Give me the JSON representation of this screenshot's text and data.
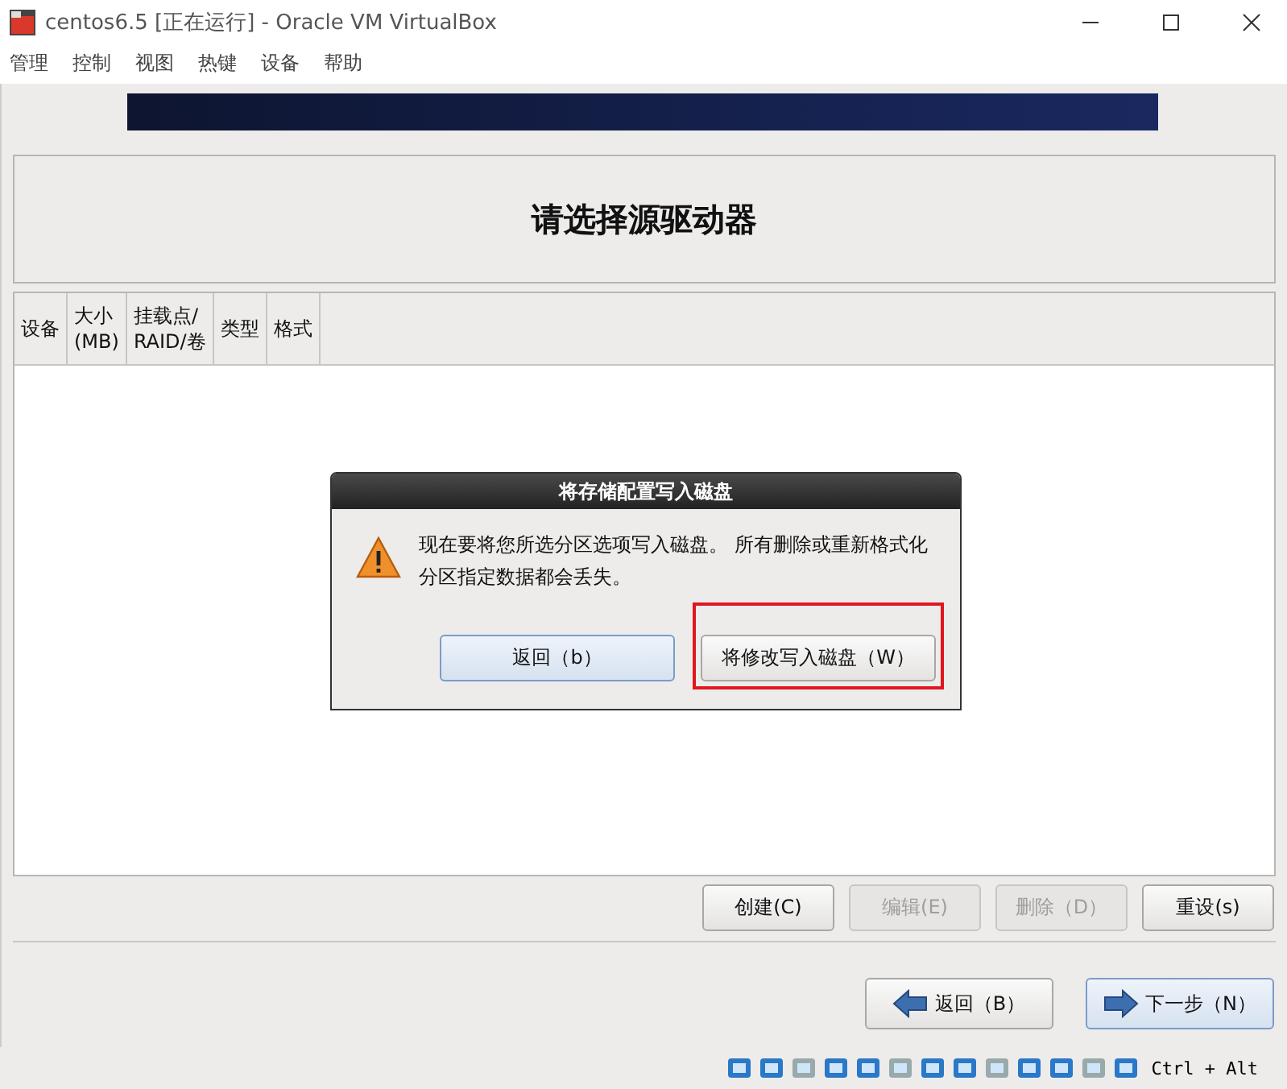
{
  "window": {
    "title": "centos6.5 [正在运行] - Oracle VM VirtualBox"
  },
  "menu": [
    "管理",
    "控制",
    "视图",
    "热键",
    "设备",
    "帮助"
  ],
  "page_title": "请选择源驱动器",
  "table": {
    "columns": [
      [
        "设备"
      ],
      [
        "大小",
        "(MB)"
      ],
      [
        "挂载点/",
        "RAID/卷"
      ],
      [
        "类型"
      ],
      [
        "格式"
      ]
    ]
  },
  "dialog": {
    "title": "将存储配置写入磁盘",
    "message": "现在要将您所选分区选项写入磁盘。 所有删除或重新格式化分区指定数据都会丢失。",
    "buttons": [
      {
        "label": "返回（b）",
        "focused": true,
        "highlighted": false
      },
      {
        "label": "将修改写入磁盘（W）",
        "focused": false,
        "highlighted": true
      }
    ]
  },
  "actions": [
    {
      "label": "创建(C)",
      "disabled": false
    },
    {
      "label": "编辑(E)",
      "disabled": true
    },
    {
      "label": "删除（D）",
      "disabled": true
    },
    {
      "label": "重设(s)",
      "disabled": false
    }
  ],
  "nav": [
    {
      "label": "返回（B）",
      "kind": "back",
      "focused": false
    },
    {
      "label": "下一步（N）",
      "kind": "next",
      "focused": true
    }
  ],
  "status_bar": {
    "host_key": "Ctrl + Alt"
  }
}
